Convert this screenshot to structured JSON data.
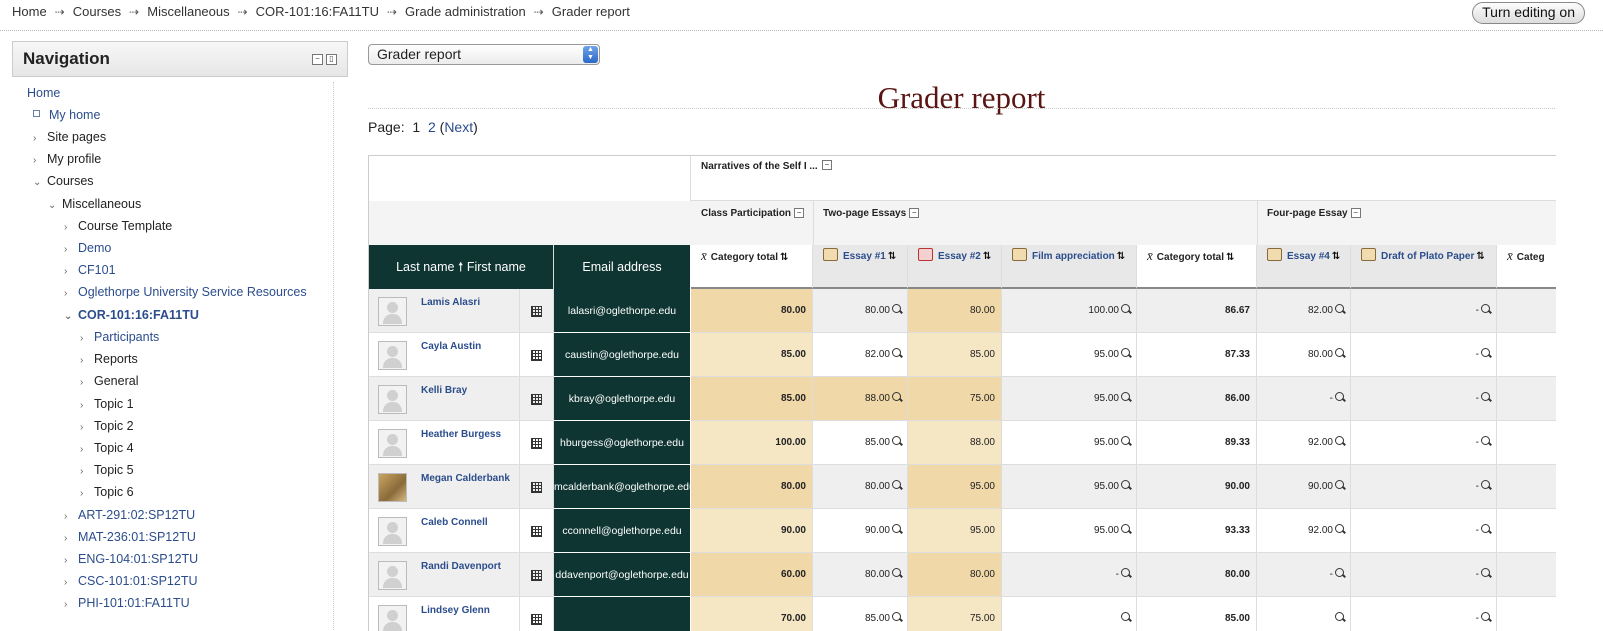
{
  "breadcrumbs": [
    "Home",
    "Courses",
    "Miscellaneous",
    "COR-101:16:FA11TU",
    "Grade administration",
    "Grader report"
  ],
  "crumb_separator": "⇢",
  "edit_button": "Turn editing on",
  "nav": {
    "title": "Navigation",
    "items": [
      {
        "label": "Home",
        "type": "link"
      },
      {
        "label": "My home",
        "type": "link"
      },
      {
        "label": "Site pages",
        "type": "plain"
      },
      {
        "label": "My profile",
        "type": "plain"
      },
      {
        "label": "Courses",
        "type": "plain"
      },
      {
        "label": "Miscellaneous",
        "type": "plain"
      },
      {
        "label": "Course Template",
        "type": "plain"
      },
      {
        "label": "Demo",
        "type": "link"
      },
      {
        "label": "CF101",
        "type": "link"
      },
      {
        "label": "Oglethorpe University Service Resources",
        "type": "link"
      },
      {
        "label": "COR-101:16:FA11TU",
        "type": "bold"
      },
      {
        "label": "Participants",
        "type": "link"
      },
      {
        "label": "Reports",
        "type": "plain"
      },
      {
        "label": "General",
        "type": "plain"
      },
      {
        "label": "Topic 1",
        "type": "plain"
      },
      {
        "label": "Topic 2",
        "type": "plain"
      },
      {
        "label": "Topic 4",
        "type": "plain"
      },
      {
        "label": "Topic 5",
        "type": "plain"
      },
      {
        "label": "Topic 6",
        "type": "plain"
      },
      {
        "label": "ART-291:02:SP12TU",
        "type": "link"
      },
      {
        "label": "MAT-236:01:SP12TU",
        "type": "link"
      },
      {
        "label": "ENG-104:01:SP12TU",
        "type": "link"
      },
      {
        "label": "CSC-101:01:SP12TU",
        "type": "link"
      },
      {
        "label": "PHI-101:01:FA11TU",
        "type": "link"
      }
    ]
  },
  "report_select": "Grader report",
  "page_title": "Grader report",
  "paging": {
    "label": "Page:",
    "current": "1",
    "other": "2",
    "next": "Next",
    "open": "(",
    "close": ")"
  },
  "grid": {
    "top_category": "Narratives of the Self I ...",
    "categories": [
      "Class Participation",
      "Two-page Essays",
      "Four-page Essay"
    ],
    "header_last": "Last name",
    "header_first": "First name",
    "header_email": "Email address",
    "cat_total": "Category total",
    "columns": [
      "Essay #1",
      "Essay #2",
      "Film appreciation",
      "Essay #4",
      "Draft of Plato Paper",
      "Categ"
    ],
    "students": [
      {
        "name": "Lamis Alasri",
        "email": "lalasri@oglethorpe.edu",
        "values": [
          "80.00",
          "80.00",
          "80.00",
          "100.00",
          "86.67",
          "82.00",
          "-"
        ]
      },
      {
        "name": "Cayla Austin",
        "email": "caustin@oglethorpe.edu",
        "values": [
          "85.00",
          "82.00",
          "85.00",
          "95.00",
          "87.33",
          "80.00",
          "-"
        ]
      },
      {
        "name": "Kelli Bray",
        "email": "kbray@oglethorpe.edu",
        "values": [
          "85.00",
          "88.00",
          "75.00",
          "95.00",
          "86.00",
          "-",
          "-"
        ]
      },
      {
        "name": "Heather Burgess",
        "email": "hburgess@oglethorpe.edu",
        "values": [
          "100.00",
          "85.00",
          "88.00",
          "95.00",
          "89.33",
          "92.00",
          "-"
        ]
      },
      {
        "name": "Megan Calderbank",
        "email": "mcalderbank@oglethorpe.edu",
        "values": [
          "80.00",
          "80.00",
          "95.00",
          "95.00",
          "90.00",
          "90.00",
          "-"
        ]
      },
      {
        "name": "Caleb Connell",
        "email": "cconnell@oglethorpe.edu",
        "values": [
          "90.00",
          "90.00",
          "95.00",
          "95.00",
          "93.33",
          "92.00",
          "-"
        ]
      },
      {
        "name": "Randi Davenport",
        "email": "ddavenport@oglethorpe.edu",
        "values": [
          "60.00",
          "80.00",
          "80.00",
          "-",
          "80.00",
          "-",
          "-"
        ]
      },
      {
        "name": "Lindsey Glenn",
        "email": "",
        "values": [
          "70.00",
          "85.00",
          "75.00",
          "",
          "85.00",
          "",
          "-"
        ]
      }
    ]
  }
}
